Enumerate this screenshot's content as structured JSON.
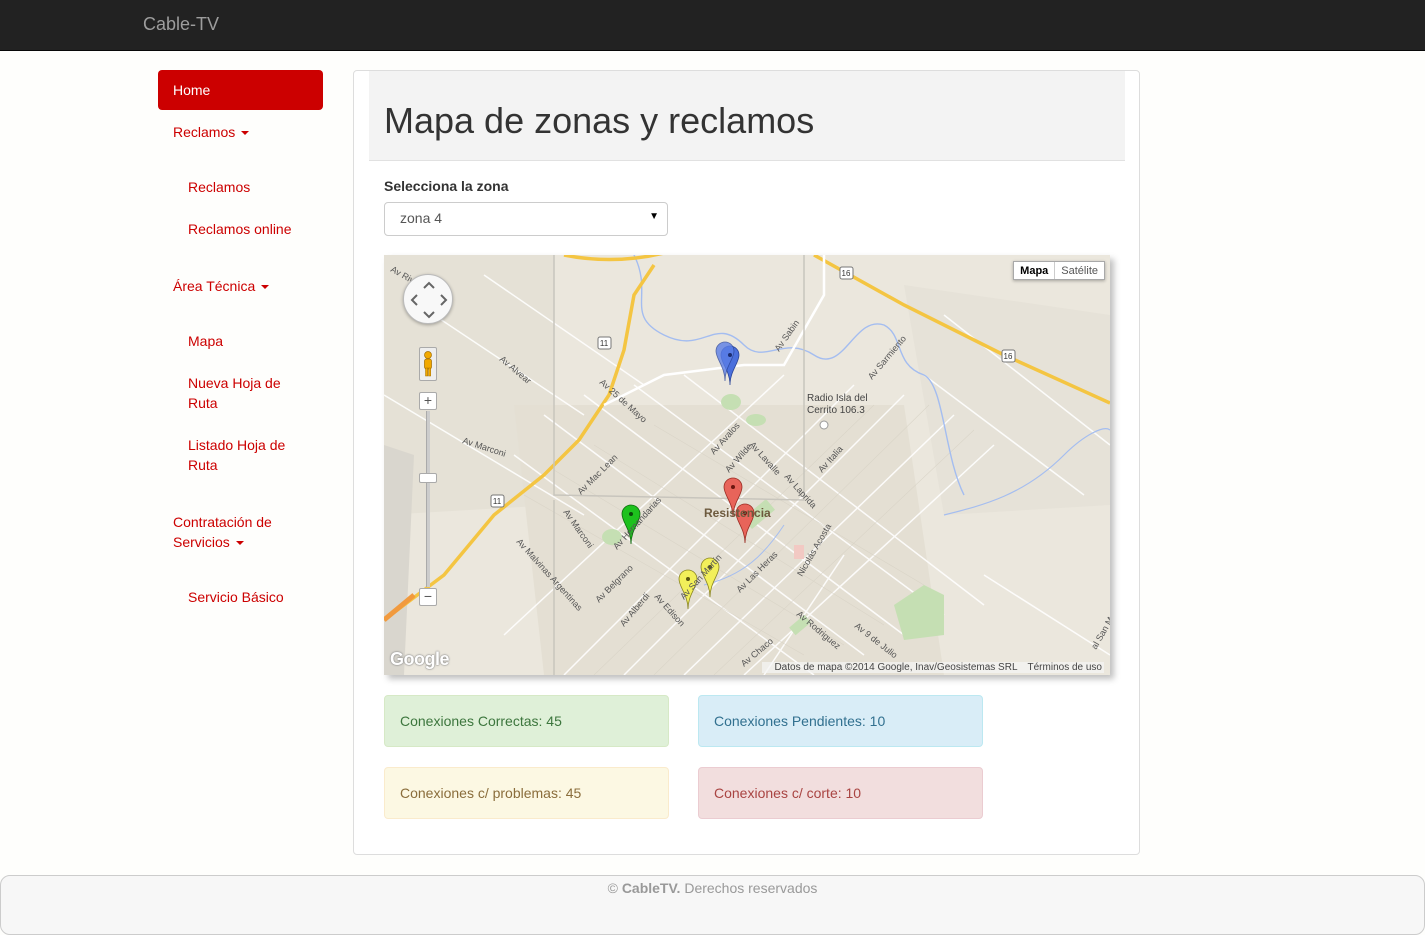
{
  "navbar": {
    "brand": "Cable-TV"
  },
  "sidebar": {
    "home": "Home",
    "reclamos_header": "Reclamos",
    "reclamos_items": [
      "Reclamos",
      "Reclamos online"
    ],
    "area_tecnica_header": "Área Técnica",
    "area_tecnica_items": [
      "Mapa",
      "Nueva Hoja de Ruta",
      "Listado Hoja de Ruta"
    ],
    "contratacion_header": "Contratación de Servicios",
    "contratacion_items": [
      "Servicio Básico"
    ]
  },
  "main": {
    "title": "Mapa de zonas y reclamos",
    "zone_label": "Selecciona la zona",
    "zone_selected": "zona 4"
  },
  "map": {
    "type_map": "Mapa",
    "type_satellite": "Satélite",
    "place_radio": "Radio Isla del Cerrito 106.3",
    "city_label": "Resistencia",
    "attribution": "Datos de mapa ©2014 Google, Inav/Geosistemas SRL",
    "terms": "Términos de uso",
    "logo": "Google",
    "route_11": "11",
    "route_16": "16",
    "streets": [
      "Av Alvear",
      "Av 25 de Mayo",
      "Av Marconi",
      "Av Mac Lean",
      "Av Hernandarias",
      "Av Avalos",
      "Av Wilde",
      "Av Lavalle",
      "Av Laprida",
      "Av Italia",
      "Av Sabin",
      "Av Sarmiento",
      "Av Belgrano",
      "Av Alberdi",
      "Av Edison",
      "Av San Martín",
      "Av Las Heras",
      "Nicolás Acosta",
      "Av Rodriguez",
      "Av 9 de Julio",
      "Av Chaco",
      "Av Malvinas Argentinas"
    ],
    "markers": [
      {
        "color": "blue",
        "hex": "#4a6fdc"
      },
      {
        "color": "red",
        "hex": "#e8645a"
      },
      {
        "color": "green",
        "hex": "#1dc11d"
      },
      {
        "color": "yellow",
        "hex": "#f2ef5a"
      }
    ]
  },
  "stats": {
    "correctas": "Conexiones Correctas: 45",
    "pendientes": "Conexiones Pendientes: 10",
    "problemas": "Conexiones c/ problemas: 45",
    "corte": "Conexiones c/ corte: 10"
  },
  "footer": {
    "copyright": "©",
    "brand": "CableTV.",
    "text": "Derechos reservados"
  },
  "colors": {
    "accent": "#cc0000",
    "navbar": "#222222"
  }
}
